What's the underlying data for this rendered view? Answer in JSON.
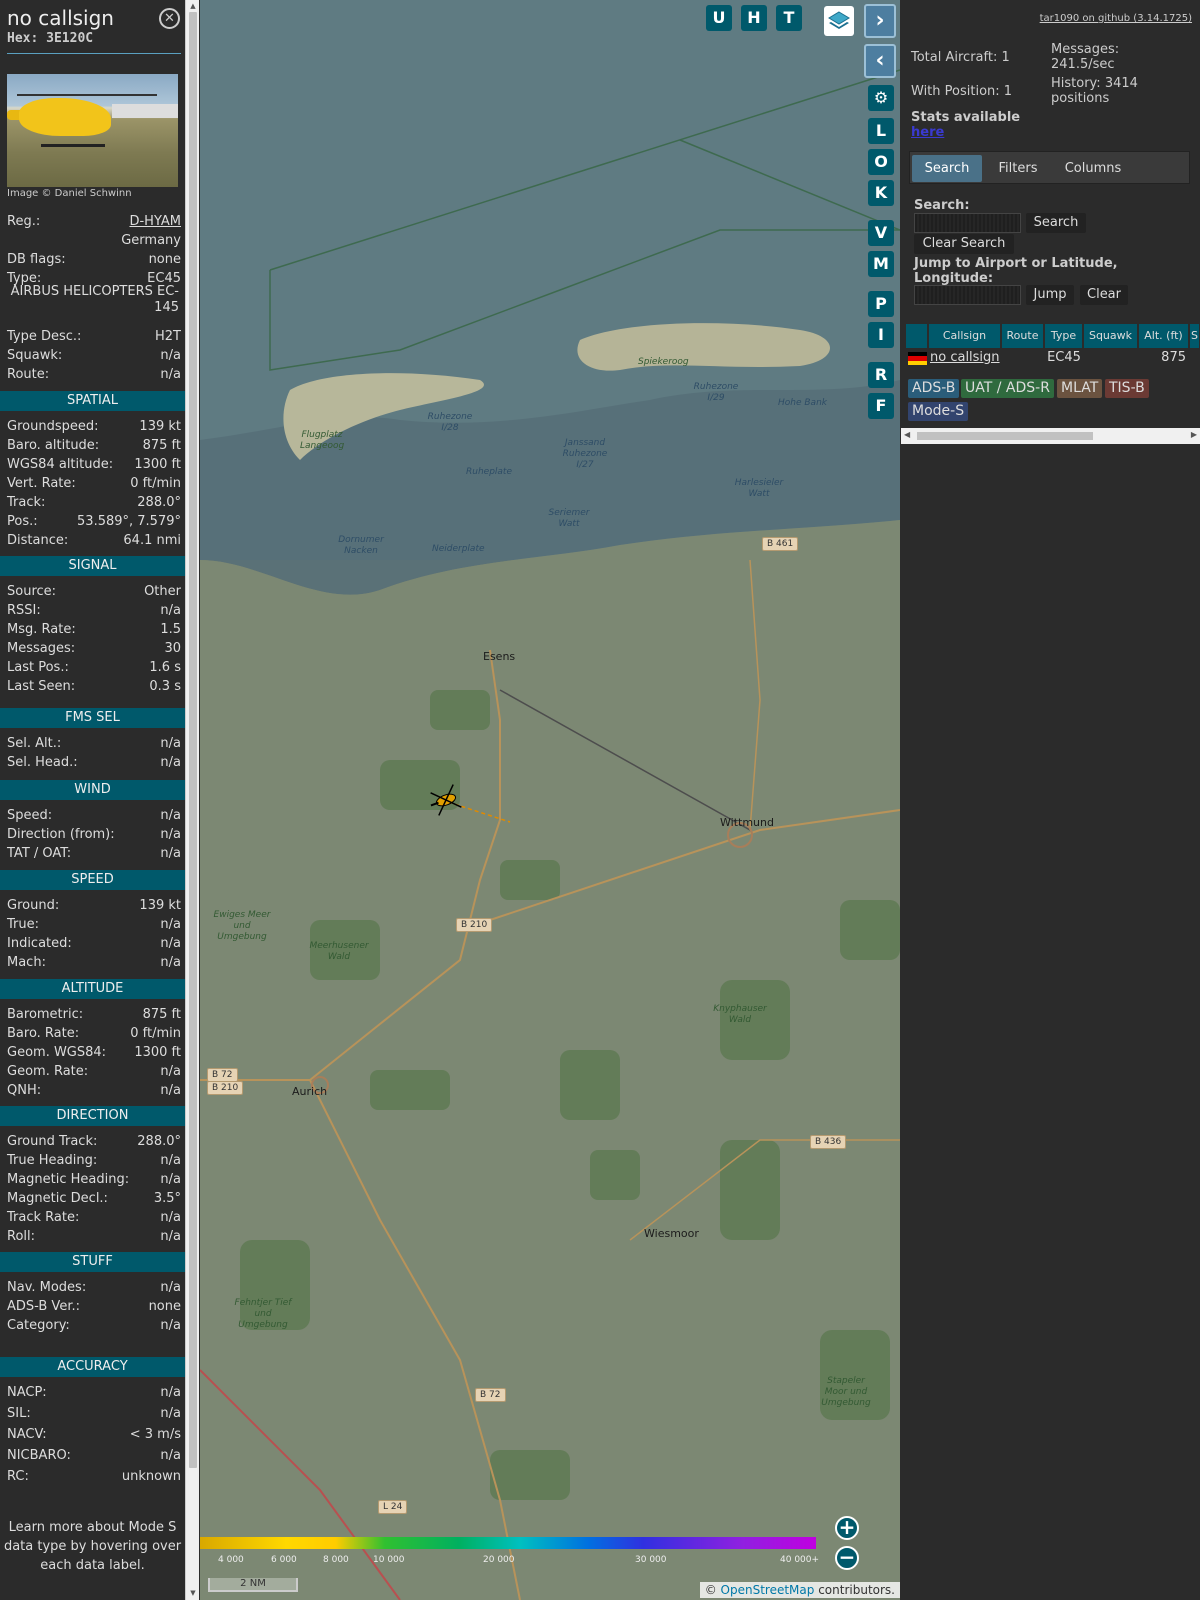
{
  "info": {
    "callsign": "no callsign",
    "hex": "Hex: 3E120C",
    "photo_credit": "Image © Daniel Schwinn",
    "details": [
      {
        "label": "Reg.:",
        "value": "D-HYAM"
      },
      {
        "label": "",
        "value": "Germany"
      },
      {
        "label": "DB flags:",
        "value": "none"
      },
      {
        "label": "Type:",
        "value": "EC45"
      }
    ],
    "full_type": "AIRBUS HELICOPTERS EC-145",
    "details2": [
      {
        "label": "Type Desc.:",
        "value": "H2T"
      },
      {
        "label": "Squawk:",
        "value": "n/a"
      },
      {
        "label": "Route:",
        "value": "n/a"
      }
    ],
    "sections": [
      {
        "title": "SPATIAL",
        "rows": [
          {
            "label": "Groundspeed:",
            "value": "139 kt"
          },
          {
            "label": "Baro. altitude:",
            "value": "875 ft"
          },
          {
            "label": "WGS84 altitude:",
            "value": "1300 ft"
          },
          {
            "label": "Vert. Rate:",
            "value": "0 ft/min"
          },
          {
            "label": "Track:",
            "value": "288.0°"
          },
          {
            "label": "Pos.:",
            "value": "53.589°, 7.579°"
          },
          {
            "label": "Distance:",
            "value": "64.1 nmi"
          }
        ]
      },
      {
        "title": "SIGNAL",
        "rows": [
          {
            "label": "Source:",
            "value": "Other"
          },
          {
            "label": "RSSI:",
            "value": "n/a"
          },
          {
            "label": "Msg. Rate:",
            "value": "1.5"
          },
          {
            "label": "Messages:",
            "value": "30"
          },
          {
            "label": "Last Pos.:",
            "value": "1.6 s"
          },
          {
            "label": "Last Seen:",
            "value": "0.3 s"
          }
        ]
      },
      {
        "title": "FMS SEL",
        "rows": [
          {
            "label": "Sel. Alt.:",
            "value": "n/a"
          },
          {
            "label": "Sel. Head.:",
            "value": "n/a"
          }
        ]
      },
      {
        "title": "WIND",
        "rows": [
          {
            "label": "Speed:",
            "value": "n/a"
          },
          {
            "label": "Direction (from):",
            "value": "n/a"
          },
          {
            "label": "TAT / OAT:",
            "value": "n/a"
          }
        ]
      },
      {
        "title": "SPEED",
        "rows": [
          {
            "label": "Ground:",
            "value": "139 kt"
          },
          {
            "label": "True:",
            "value": "n/a"
          },
          {
            "label": "Indicated:",
            "value": "n/a"
          },
          {
            "label": "Mach:",
            "value": "n/a"
          }
        ]
      },
      {
        "title": "ALTITUDE",
        "rows": [
          {
            "label": "Barometric:",
            "value": "875 ft"
          },
          {
            "label": "Baro. Rate:",
            "value": "0 ft/min"
          },
          {
            "label": "Geom. WGS84:",
            "value": "1300 ft"
          },
          {
            "label": "Geom. Rate:",
            "value": "n/a"
          },
          {
            "label": "QNH:",
            "value": "n/a"
          }
        ]
      },
      {
        "title": "DIRECTION",
        "rows": [
          {
            "label": "Ground Track:",
            "value": "288.0°"
          },
          {
            "label": "True Heading:",
            "value": "n/a"
          },
          {
            "label": "Magnetic Heading:",
            "value": "n/a"
          },
          {
            "label": "Magnetic Decl.:",
            "value": "3.5°"
          },
          {
            "label": "Track Rate:",
            "value": "n/a"
          },
          {
            "label": "Roll:",
            "value": "n/a"
          }
        ]
      },
      {
        "title": "STUFF",
        "rows": [
          {
            "label": "Nav. Modes:",
            "value": "n/a"
          },
          {
            "label": "ADS-B Ver.:",
            "value": "none"
          },
          {
            "label": "Category:",
            "value": "n/a"
          }
        ]
      },
      {
        "title": "ACCURACY",
        "rows": [
          {
            "label": "NACP:",
            "value": "n/a"
          },
          {
            "label": "SIL:",
            "value": "n/a"
          },
          {
            "label": "NACV:",
            "value": "< 3 m/s"
          },
          {
            "label": "NICBARO:",
            "value": "n/a"
          },
          {
            "label": "RC:",
            "value": "unknown"
          }
        ]
      }
    ],
    "learn_more": "Learn more about Mode S data type by hovering over each data label."
  },
  "map": {
    "buttons_top": [
      "U",
      "H",
      "T"
    ],
    "buttons_side": [
      "L",
      "O",
      "K",
      "V",
      "M",
      "P",
      "I",
      "R",
      "F"
    ],
    "towns": [
      "Esens",
      "Wittmund",
      "Aurich",
      "Wiesmoor"
    ],
    "islands": [
      "Spiekeroog",
      "Flugplatz Langeoog"
    ],
    "sea_labels": [
      "Ruhezone I/28",
      "Ruheplate",
      "Janssand Ruhezone I/27",
      "Ruhezone I/29",
      "Hohe Bank",
      "Harlesieler Watt",
      "Seriemer Watt",
      "Dornumer Nacken",
      "Neiderplate"
    ],
    "nature_labels": [
      "Ewiges Meer und Umgebung",
      "Meerhusener Wald",
      "Knyphauser Wald",
      "Fehntjer Tief und Umgebung",
      "Stapeler Moor und Umgebung"
    ],
    "roads": [
      "B 461",
      "B 210",
      "B 72",
      "B 210",
      "B 436",
      "B 72",
      "L 24"
    ],
    "legend_ticks": [
      "4 000",
      "6 000",
      "8 000",
      "10 000",
      "20 000",
      "30 000",
      "40 000+"
    ],
    "scale": "2 NM",
    "attribution_symbol": "©",
    "attribution_link": "OpenStreetMap",
    "attribution_rest": "contributors."
  },
  "sidebar": {
    "github": "tar1090 on github (3.14.1725)",
    "total_aircraft": "Total Aircraft: 1",
    "with_position": "With Position: 1",
    "messages_label": "Messages:",
    "messages_value": "241.5/sec",
    "history_label": "History: 3414",
    "history_value": "positions",
    "stats_available": "Stats available",
    "stats_link": "here",
    "tabs": [
      "Search",
      "Filters",
      "Columns"
    ],
    "search_label": "Search:",
    "search_button": "Search",
    "clear_search_button": "Clear Search",
    "jump_label": "Jump to Airport or Latitude, Longitude:",
    "jump_button": "Jump",
    "clear_button": "Clear",
    "table_headers": [
      "Callsign",
      "Route",
      "Type",
      "Squawk",
      "Alt. (ft)",
      "S"
    ],
    "table_row": {
      "callsign": "no callsign",
      "type": "EC45",
      "alt": "875"
    },
    "source_tags": [
      {
        "label": "ADS-B",
        "color": "#2a5d7a"
      },
      {
        "label": "UAT / ADS-R",
        "color": "#2f6a3e"
      },
      {
        "label": "MLAT",
        "color": "#6b5340"
      },
      {
        "label": "TIS-B",
        "color": "#6b3a34"
      },
      {
        "label": "Mode-S",
        "color": "#32446e"
      }
    ]
  }
}
